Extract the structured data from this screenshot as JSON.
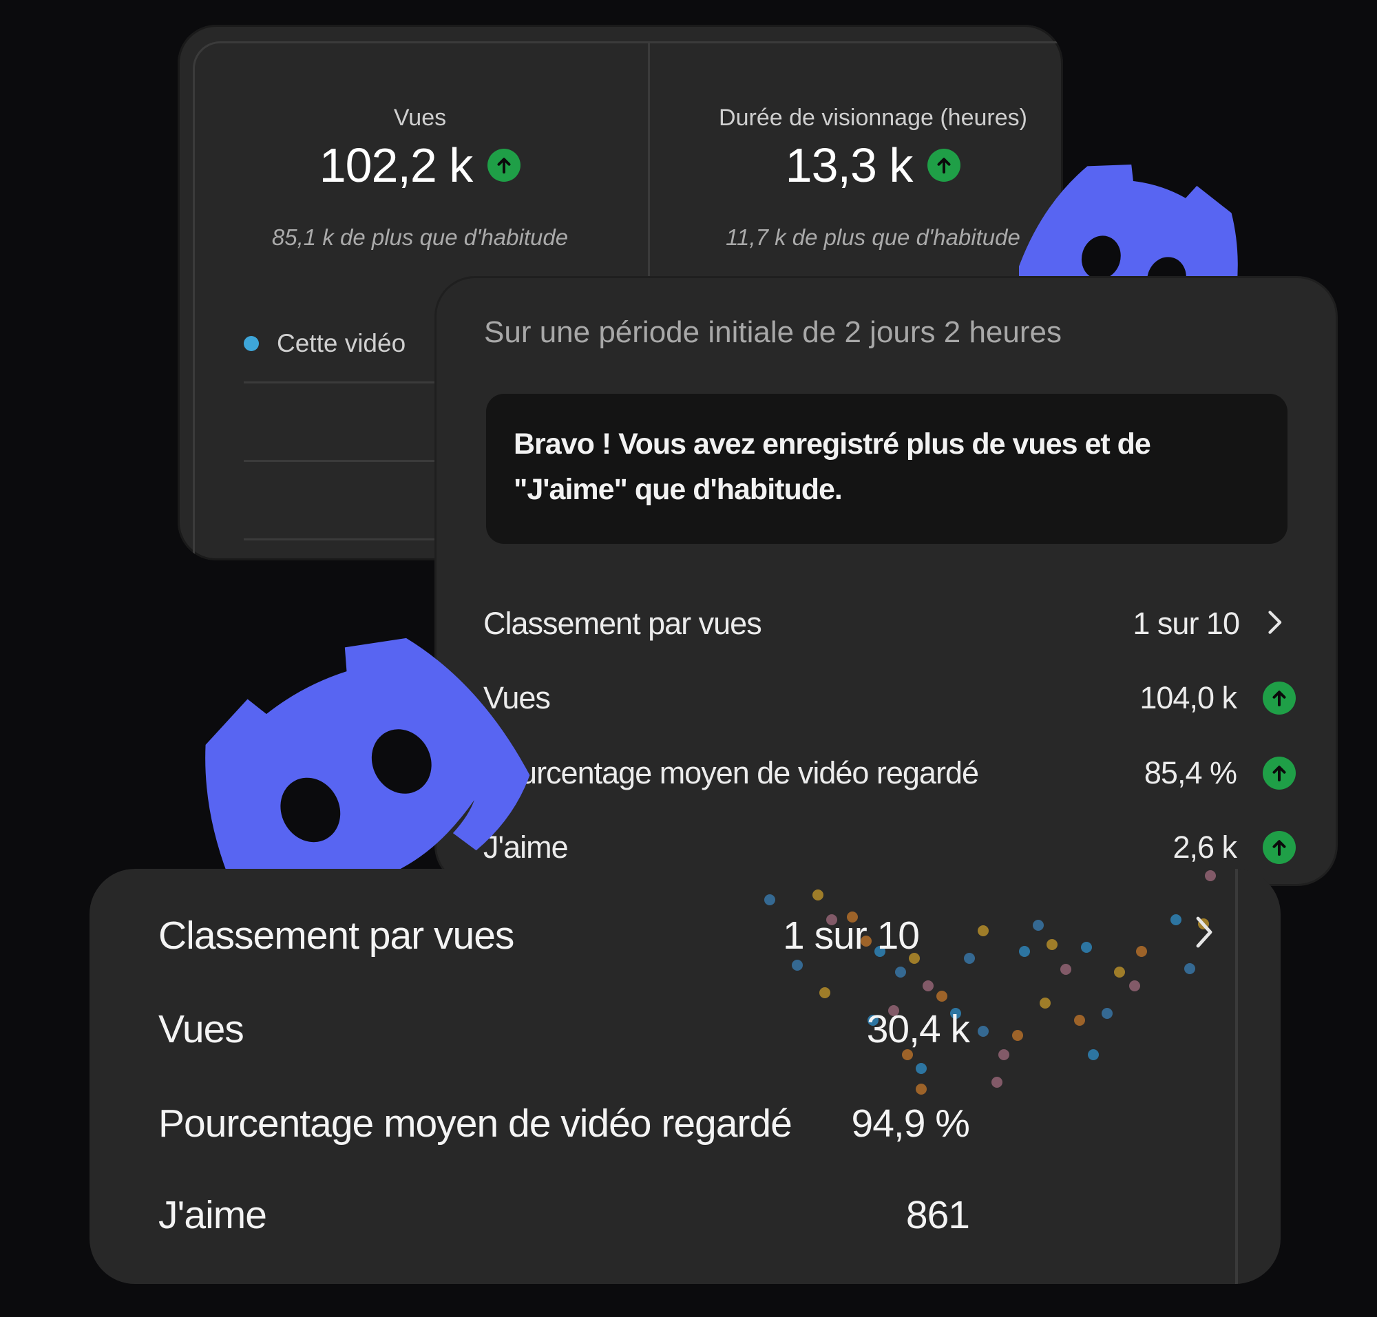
{
  "top_card": {
    "metrics": [
      {
        "label": "Vues",
        "value": "102,2 k",
        "delta": "85,1 k de plus que d'habitude",
        "trend": "up"
      },
      {
        "label": "Durée de visionnage (heures)",
        "value": "13,3 k",
        "delta": "11,7 k de plus que d'habitude",
        "trend": "up"
      }
    ],
    "legend": {
      "label": "Cette vidéo",
      "color": "#3ea6d9"
    }
  },
  "popup_card": {
    "period": "Sur une période initiale de 2 jours 2 heures",
    "message": "Bravo ! Vous avez enregistré plus de vues et de \"J'aime\" que d'habitude.",
    "rank": {
      "label": "Classement par vues",
      "value": "1 sur 10",
      "icon": "chevron-right-icon"
    },
    "rows": [
      {
        "label": "Vues",
        "value": "104,0 k",
        "trend": "up"
      },
      {
        "label": "Pourcentage moyen de vidéo regardé",
        "value": "85,4 %",
        "trend": "up"
      },
      {
        "label": "J'aime",
        "value": "2,6 k",
        "trend": "up"
      }
    ]
  },
  "bottom_card": {
    "rank": {
      "label": "Classement par vues",
      "value": "1 sur 10",
      "icon": "chevron-right-icon"
    },
    "rows": [
      {
        "label": "Vues",
        "value": "30,4 k"
      },
      {
        "label": "Pourcentage moyen de vidéo regardé",
        "value": "94,9 %"
      },
      {
        "label": "J'aime",
        "value": "861"
      }
    ]
  },
  "decorations": {
    "logo_icon": "discord-logo-icon",
    "logo_color": "#5865f2",
    "trend_up_color": "#1f9f47"
  }
}
